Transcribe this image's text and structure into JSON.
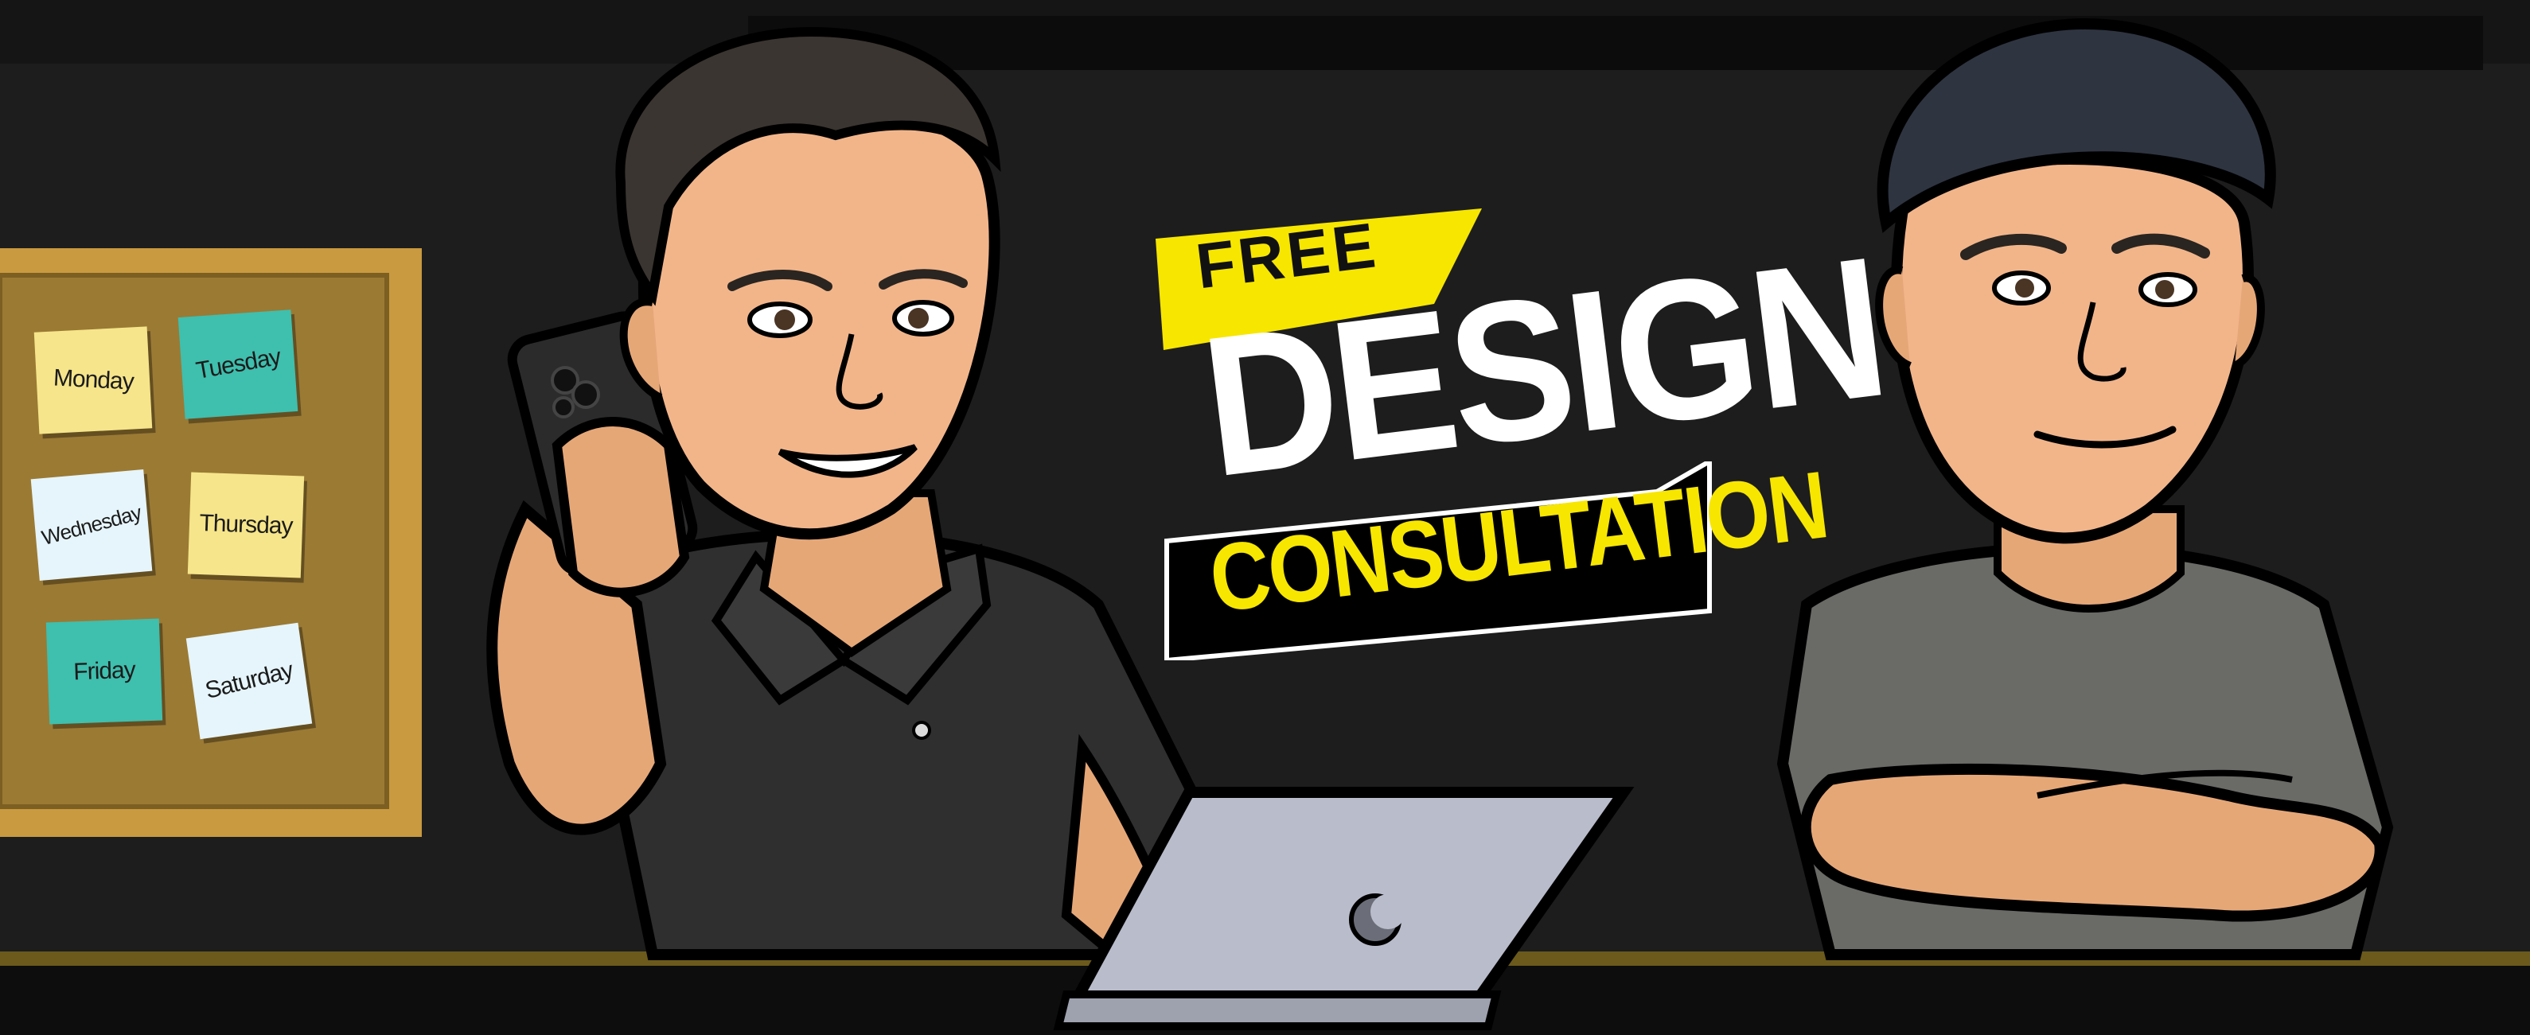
{
  "headline": {
    "free": "FREE",
    "design": "DESIGN",
    "consultation": "CONSULTATION"
  },
  "board": {
    "notes": [
      {
        "label": "Monday",
        "color": "#f6e58a"
      },
      {
        "label": "Tuesday",
        "color": "#3fbfae"
      },
      {
        "label": "Wednesday",
        "color": "#e6f5fb"
      },
      {
        "label": "Thursday",
        "color": "#f6e58a"
      },
      {
        "label": "Friday",
        "color": "#3fbfae"
      },
      {
        "label": "Saturday",
        "color": "#e6f5fb"
      }
    ]
  },
  "colors": {
    "background": "#1d1d1d",
    "accent_yellow": "#f7e600",
    "board_frame": "#c99a3f",
    "board_cork": "#9b7a34",
    "floor_stripe": "#6b5a1c"
  }
}
